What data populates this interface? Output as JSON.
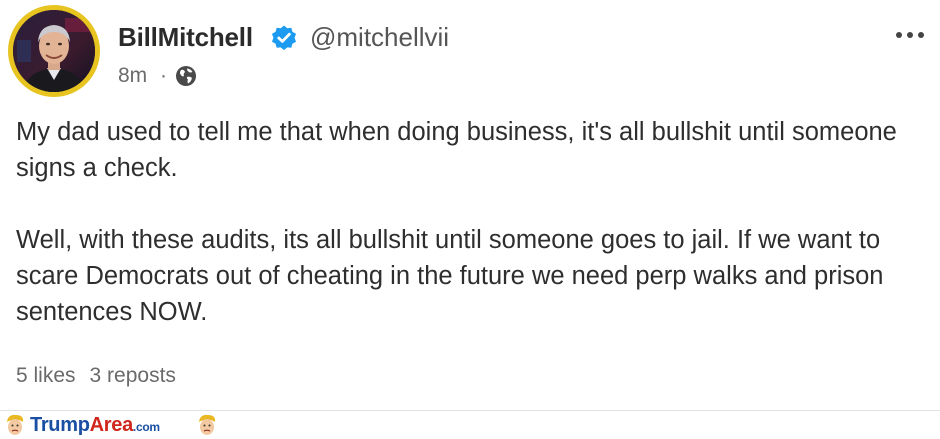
{
  "post": {
    "author": {
      "display_name": "BillMitchell",
      "handle": "@mitchellvii",
      "verified": true
    },
    "meta": {
      "time": "8m",
      "separator": "·",
      "visibility_icon": "globe-icon"
    },
    "menu_icon": "more-horizontal-icon",
    "paragraphs": [
      "My dad used to tell me that when doing business, it's all bullshit until someone signs a check.",
      "Well, with these audits, its all bullshit until someone goes to jail. If we want to scare Democrats out of cheating in the future we need perp walks and prison sentences NOW."
    ],
    "stats": {
      "likes": "5 likes",
      "reposts": "3 reposts"
    }
  },
  "watermark": {
    "part1": "Trump",
    "part2": "Area",
    "part3": ".com"
  },
  "colors": {
    "avatar_ring": "#e7c41f",
    "verified_badge": "#1d9bf0",
    "watermark_blue": "#1a4fa3",
    "watermark_red": "#d0261d"
  }
}
